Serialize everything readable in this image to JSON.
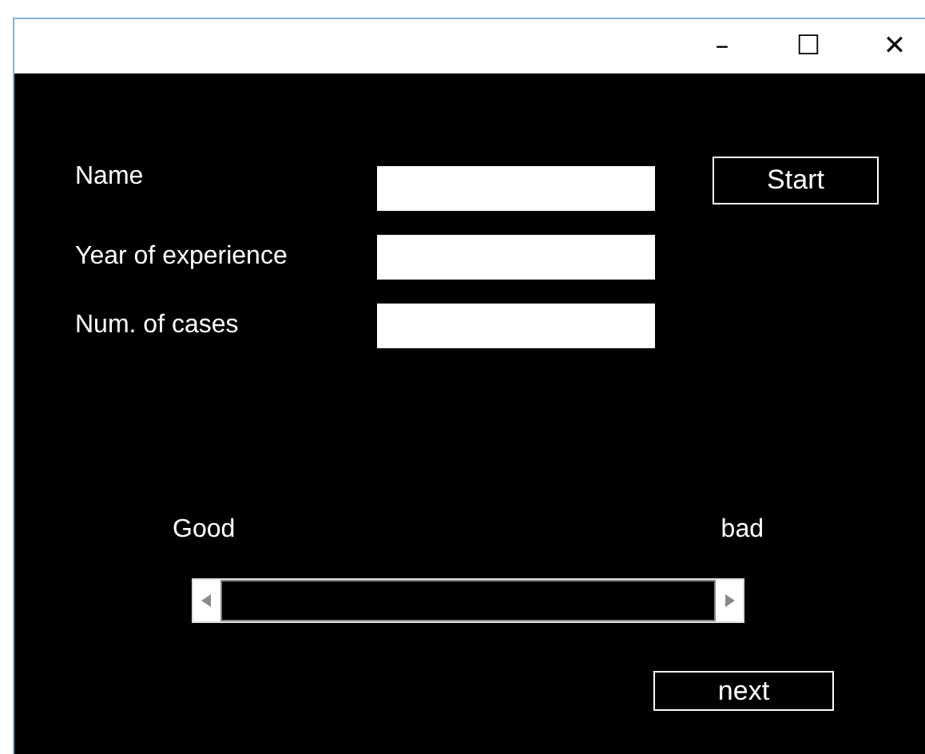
{
  "window": {
    "controls": [
      "–",
      "☐",
      "✕"
    ]
  },
  "form": {
    "fields": [
      {
        "label": "Name"
      },
      {
        "label": "Year of experience"
      },
      {
        "label": "Num. of cases"
      }
    ],
    "start_button": "Start"
  },
  "rating": {
    "left_label": "Good",
    "right_label": "bad"
  },
  "next_button": "next"
}
